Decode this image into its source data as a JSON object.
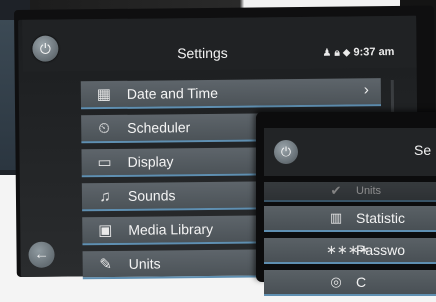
{
  "main": {
    "title": "Settings",
    "status": {
      "time": "9:37 am",
      "icons": [
        "person-icon",
        "lock-icon",
        "wifi-icon"
      ]
    },
    "menu": [
      {
        "label": "Date and Time",
        "icon": "calendar-icon",
        "glyph": "▦",
        "chevron": "›"
      },
      {
        "label": "Scheduler",
        "icon": "scheduler-icon",
        "glyph": "⏲"
      },
      {
        "label": "Display",
        "icon": "monitor-icon",
        "glyph": "▭"
      },
      {
        "label": "Sounds",
        "icon": "music-note-icon",
        "glyph": "♫"
      },
      {
        "label": "Media Library",
        "icon": "media-library-icon",
        "glyph": "▣"
      },
      {
        "label": "Units",
        "icon": "ruler-icon",
        "glyph": "✎"
      }
    ],
    "power_glyph": "⏻",
    "back_glyph": "←"
  },
  "overlay": {
    "title": "Se",
    "power_glyph": "⏻",
    "menu": [
      {
        "label": "Units",
        "icon": "units-icon",
        "glyph": "✔"
      },
      {
        "label": "Statistic",
        "icon": "bar-chart-icon",
        "glyph": "▥"
      },
      {
        "label": "Passwo",
        "icon": "password-icon",
        "glyph": "∗∗∗∗"
      },
      {
        "label": "C",
        "icon": "settings-icon",
        "glyph": "◎"
      }
    ]
  },
  "colors": {
    "accent": "#5f8fb1",
    "item_bg": "#555c61"
  }
}
